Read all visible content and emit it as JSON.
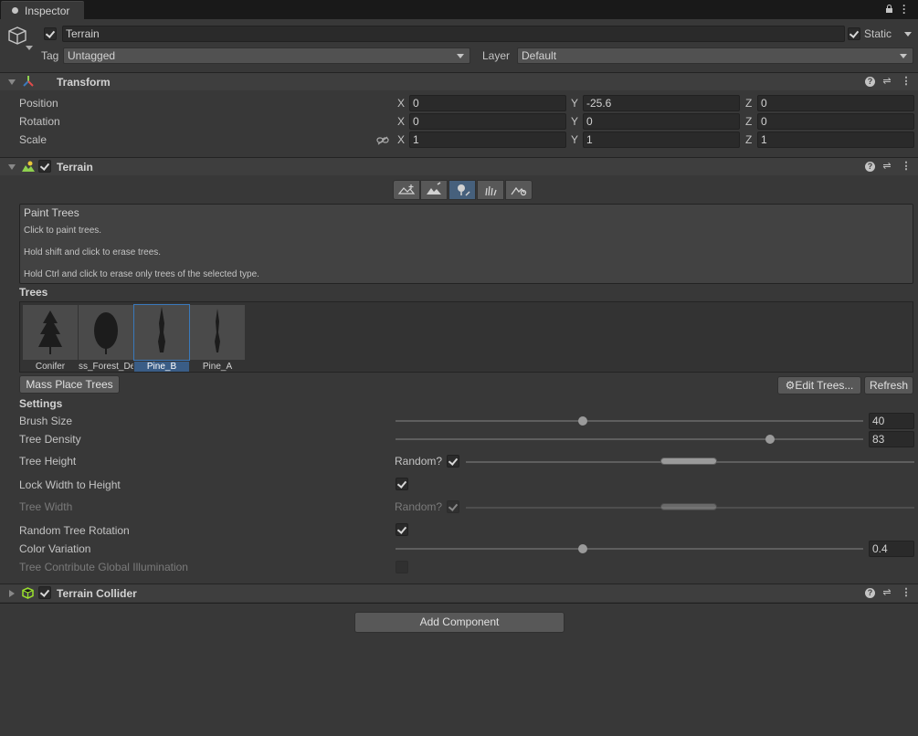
{
  "window": {
    "tab_label": "Inspector"
  },
  "object": {
    "name": "Terrain",
    "static_label": "Static",
    "tag_label": "Tag",
    "tag_value": "Untagged",
    "layer_label": "Layer",
    "layer_value": "Default",
    "active": true,
    "static": true
  },
  "transform": {
    "title": "Transform",
    "rows": [
      {
        "label": "Position",
        "x": "0",
        "y": "-25.6",
        "z": "0"
      },
      {
        "label": "Rotation",
        "x": "0",
        "y": "0",
        "z": "0"
      },
      {
        "label": "Scale",
        "x": "1",
        "y": "1",
        "z": "1"
      }
    ],
    "axes": {
      "x": "X",
      "y": "Y",
      "z": "Z"
    }
  },
  "terrain": {
    "title": "Terrain",
    "paint_title": "Paint Trees",
    "help_lines": [
      "Click to paint trees.",
      "Hold shift and click to erase trees.",
      "Hold Ctrl and click to erase only trees of the selected type."
    ],
    "trees_label": "Trees",
    "trees": [
      {
        "label": "Conifer"
      },
      {
        "label": "ss_Forest_De"
      },
      {
        "label": "Pine_B"
      },
      {
        "label": "Pine_A"
      }
    ],
    "mass_place_label": "Mass Place Trees",
    "edit_trees_label": "Edit Trees...",
    "refresh_label": "Refresh",
    "settings_label": "Settings",
    "brush_size_label": "Brush Size",
    "brush_size_value": "40",
    "brush_size_fraction": 0.4,
    "tree_density_label": "Tree Density",
    "tree_density_value": "83",
    "tree_density_fraction": 0.8,
    "tree_height_label": "Tree Height",
    "random_label": "Random?",
    "lock_width_label": "Lock Width to Height",
    "tree_width_label": "Tree Width",
    "random_rotation_label": "Random Tree Rotation",
    "color_variation_label": "Color Variation",
    "color_variation_value": "0.4",
    "color_variation_fraction": 0.4,
    "contribute_gi_label": "Tree Contribute Global Illumination"
  },
  "collider": {
    "title": "Terrain Collider"
  },
  "add_component_label": "Add Component",
  "colors": {
    "background": "#383838",
    "field": "#2a2a2a",
    "accent": "#3a79bb",
    "collider_icon": "#9be22d"
  }
}
